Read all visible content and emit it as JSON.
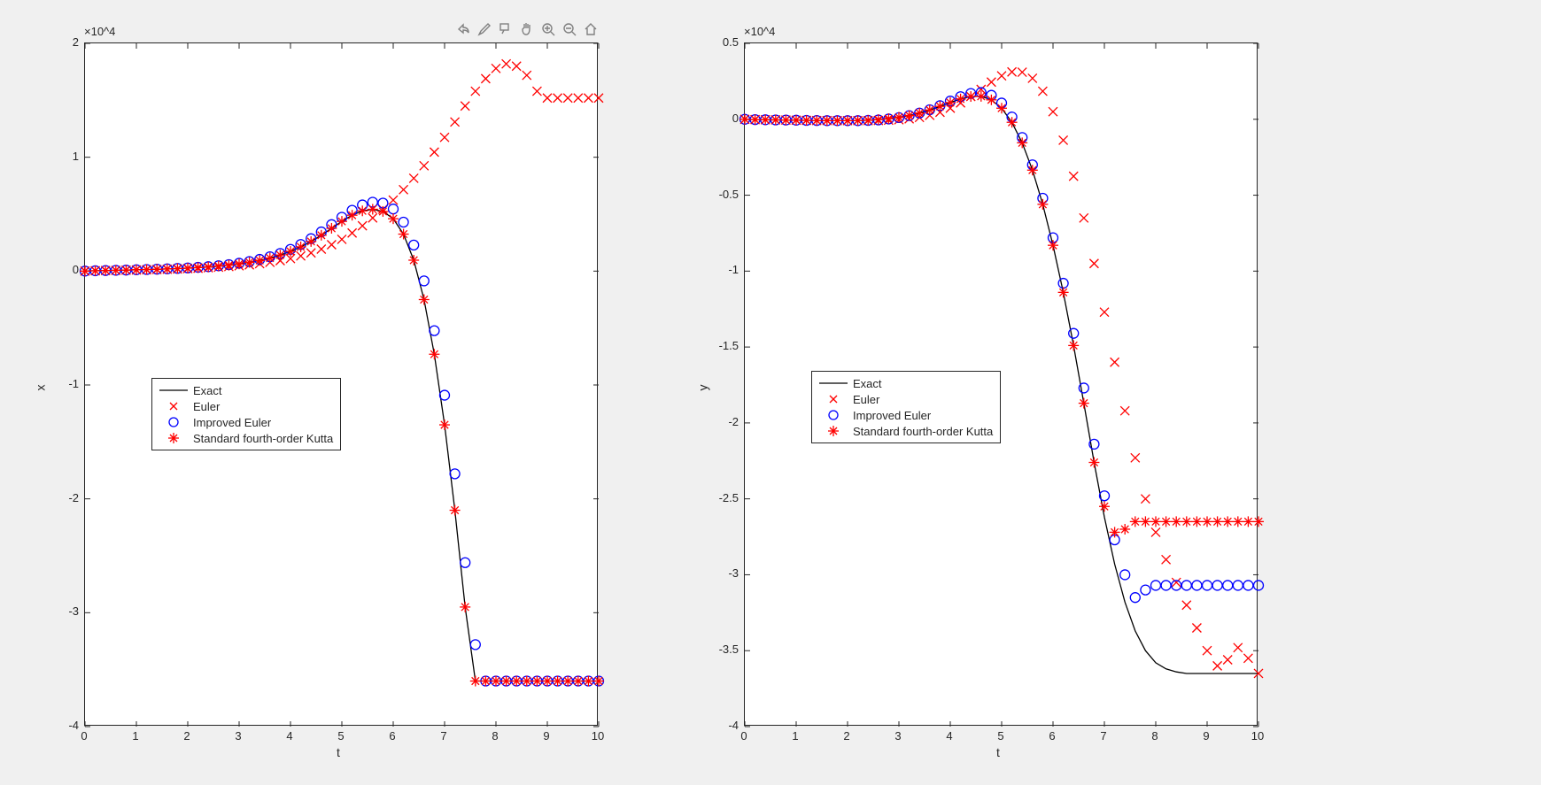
{
  "toolbar_icons": [
    "share-icon",
    "brush-icon",
    "data-tip-icon",
    "pan-icon",
    "zoom-in-icon",
    "zoom-out-icon",
    "home-icon"
  ],
  "legend": {
    "items": [
      "Exact",
      "Euler",
      "Improved Euler",
      "Standard fourth-order Kutta"
    ]
  },
  "chart_data": [
    {
      "type": "line",
      "xlabel": "t",
      "ylabel": "x",
      "xlim": [
        0,
        10
      ],
      "ylim": [
        -4,
        2
      ],
      "yscale": 10000.0,
      "yexp": "×10^4",
      "xticks": [
        0,
        1,
        2,
        3,
        4,
        5,
        6,
        7,
        8,
        9,
        10
      ],
      "yticks": [
        -4,
        -3,
        -2,
        -1,
        0,
        1,
        2
      ],
      "x": [
        0,
        0.2,
        0.4,
        0.6,
        0.8,
        1,
        1.2,
        1.4,
        1.6,
        1.8,
        2,
        2.2,
        2.4,
        2.6,
        2.8,
        3,
        3.2,
        3.4,
        3.6,
        3.8,
        4,
        4.2,
        4.4,
        4.6,
        4.8,
        5,
        5.2,
        5.4,
        5.6,
        5.8,
        6,
        6.2,
        6.4,
        6.6,
        6.8,
        7,
        7.2,
        7.4,
        7.6,
        7.8,
        8,
        8.2,
        8.4,
        8.6,
        8.8,
        9,
        9.2,
        9.4,
        9.6,
        9.8,
        10
      ],
      "series": [
        {
          "name": "Exact",
          "style": "line",
          "color": "#000000",
          "values": [
            0,
            0.003,
            0.005,
            0.007,
            0.009,
            0.012,
            0.014,
            0.016,
            0.019,
            0.022,
            0.026,
            0.031,
            0.036,
            0.044,
            0.052,
            0.063,
            0.077,
            0.094,
            0.115,
            0.141,
            0.173,
            0.213,
            0.26,
            0.315,
            0.376,
            0.437,
            0.491,
            0.529,
            0.543,
            0.524,
            0.46,
            0.325,
            0.096,
            -0.25,
            -0.73,
            -1.35,
            -2.1,
            -2.95,
            -3.6,
            -3.6,
            -3.6,
            -3.6,
            -3.6,
            -3.6,
            -3.6,
            -3.6,
            -3.6,
            -3.6,
            -3.6,
            -3.6,
            -3.6
          ]
        },
        {
          "name": "Euler",
          "style": "x",
          "color": "#ff0000",
          "values": [
            0,
            0.003,
            0.005,
            0.006,
            0.008,
            0.01,
            0.012,
            0.014,
            0.016,
            0.019,
            0.022,
            0.025,
            0.029,
            0.034,
            0.04,
            0.047,
            0.055,
            0.065,
            0.077,
            0.092,
            0.11,
            0.133,
            0.16,
            0.193,
            0.232,
            0.279,
            0.335,
            0.398,
            0.467,
            0.542,
            0.624,
            0.715,
            0.815,
            0.925,
            1.045,
            1.175,
            1.31,
            1.45,
            1.58,
            1.69,
            1.78,
            1.82,
            1.8,
            1.72,
            1.58,
            1.52,
            1.52,
            1.52,
            1.52,
            1.52,
            1.52
          ]
        },
        {
          "name": "Improved Euler",
          "style": "o",
          "color": "#0000ff",
          "values": [
            0,
            0.003,
            0.005,
            0.007,
            0.009,
            0.012,
            0.014,
            0.017,
            0.02,
            0.024,
            0.028,
            0.033,
            0.039,
            0.047,
            0.057,
            0.069,
            0.084,
            0.103,
            0.126,
            0.155,
            0.191,
            0.234,
            0.285,
            0.344,
            0.408,
            0.473,
            0.534,
            0.581,
            0.605,
            0.597,
            0.545,
            0.43,
            0.229,
            -0.086,
            -0.523,
            -1.09,
            -1.78,
            -2.56,
            -3.28,
            -3.6,
            -3.6,
            -3.6,
            -3.6,
            -3.6,
            -3.6,
            -3.6,
            -3.6,
            -3.6,
            -3.6,
            -3.6,
            -3.6
          ]
        },
        {
          "name": "Standard fourth-order Kutta",
          "style": "*",
          "color": "#ff0000",
          "values": [
            0,
            0.003,
            0.005,
            0.007,
            0.009,
            0.012,
            0.014,
            0.016,
            0.019,
            0.022,
            0.026,
            0.031,
            0.036,
            0.044,
            0.052,
            0.063,
            0.077,
            0.094,
            0.115,
            0.141,
            0.173,
            0.213,
            0.26,
            0.315,
            0.376,
            0.437,
            0.491,
            0.529,
            0.543,
            0.524,
            0.46,
            0.325,
            0.096,
            -0.25,
            -0.73,
            -1.35,
            -2.1,
            -2.95,
            -3.6,
            -3.6,
            -3.6,
            -3.6,
            -3.6,
            -3.6,
            -3.6,
            -3.6,
            -3.6,
            -3.6,
            -3.6,
            -3.6,
            -3.6
          ]
        }
      ]
    },
    {
      "type": "line",
      "xlabel": "t",
      "ylabel": "y",
      "xlim": [
        0,
        10
      ],
      "ylim": [
        -4,
        0.5
      ],
      "yscale": 10000.0,
      "yexp": "×10^4",
      "xticks": [
        0,
        1,
        2,
        3,
        4,
        5,
        6,
        7,
        8,
        9,
        10
      ],
      "yticks": [
        -4,
        -3.5,
        -3,
        -2.5,
        -2,
        -1.5,
        -1,
        -0.5,
        0,
        0.5
      ],
      "x": [
        0,
        0.2,
        0.4,
        0.6,
        0.8,
        1,
        1.2,
        1.4,
        1.6,
        1.8,
        2,
        2.2,
        2.4,
        2.6,
        2.8,
        3,
        3.2,
        3.4,
        3.6,
        3.8,
        4,
        4.2,
        4.4,
        4.6,
        4.8,
        5,
        5.2,
        5.4,
        5.6,
        5.8,
        6,
        6.2,
        6.4,
        6.6,
        6.8,
        7,
        7.2,
        7.4,
        7.6,
        7.8,
        8,
        8.2,
        8.4,
        8.6,
        8.8,
        9,
        9.2,
        9.4,
        9.6,
        9.8,
        10
      ],
      "series": [
        {
          "name": "Exact",
          "style": "line",
          "color": "#000000",
          "values": [
            0,
            -0.002,
            -0.003,
            -0.004,
            -0.005,
            -0.006,
            -0.007,
            -0.008,
            -0.009,
            -0.009,
            -0.009,
            -0.008,
            -0.006,
            -0.002,
            0.004,
            0.013,
            0.025,
            0.041,
            0.061,
            0.085,
            0.11,
            0.134,
            0.15,
            0.151,
            0.128,
            0.073,
            -0.02,
            -0.155,
            -0.335,
            -0.56,
            -0.83,
            -1.14,
            -1.49,
            -1.87,
            -2.26,
            -2.62,
            -2.93,
            -3.18,
            -3.37,
            -3.5,
            -3.58,
            -3.62,
            -3.64,
            -3.65,
            -3.65,
            -3.65,
            -3.65,
            -3.65,
            -3.65,
            -3.65,
            -3.65
          ]
        },
        {
          "name": "Euler",
          "style": "x",
          "color": "#ff0000",
          "values": [
            0,
            -0.002,
            -0.003,
            -0.004,
            -0.005,
            -0.006,
            -0.007,
            -0.008,
            -0.008,
            -0.009,
            -0.009,
            -0.009,
            -0.009,
            -0.008,
            -0.006,
            -0.003,
            0.003,
            0.012,
            0.026,
            0.046,
            0.073,
            0.108,
            0.15,
            0.197,
            0.245,
            0.286,
            0.312,
            0.31,
            0.27,
            0.185,
            0.05,
            -0.138,
            -0.375,
            -0.65,
            -0.95,
            -1.27,
            -1.6,
            -1.92,
            -2.23,
            -2.5,
            -2.72,
            -2.9,
            -3.05,
            -3.2,
            -3.35,
            -3.5,
            -3.6,
            -3.56,
            -3.48,
            -3.55,
            -3.65
          ]
        },
        {
          "name": "Improved Euler",
          "style": "o",
          "color": "#0000ff",
          "values": [
            0,
            -0.002,
            -0.003,
            -0.004,
            -0.005,
            -0.006,
            -0.007,
            -0.008,
            -0.009,
            -0.009,
            -0.009,
            -0.009,
            -0.007,
            -0.004,
            0.002,
            0.011,
            0.024,
            0.041,
            0.063,
            0.09,
            0.12,
            0.149,
            0.17,
            0.176,
            0.158,
            0.107,
            0.015,
            -0.12,
            -0.3,
            -0.52,
            -0.78,
            -1.08,
            -1.41,
            -1.77,
            -2.14,
            -2.48,
            -2.77,
            -3.0,
            -3.15,
            -3.1,
            -3.07,
            -3.07,
            -3.07,
            -3.07,
            -3.07,
            -3.07,
            -3.07,
            -3.07,
            -3.07,
            -3.07,
            -3.07
          ]
        },
        {
          "name": "Standard fourth-order Kutta",
          "style": "*",
          "color": "#ff0000",
          "values": [
            0,
            -0.002,
            -0.003,
            -0.004,
            -0.005,
            -0.006,
            -0.007,
            -0.008,
            -0.009,
            -0.009,
            -0.009,
            -0.008,
            -0.006,
            -0.002,
            0.004,
            0.013,
            0.025,
            0.041,
            0.061,
            0.085,
            0.11,
            0.134,
            0.15,
            0.151,
            0.128,
            0.073,
            -0.02,
            -0.155,
            -0.335,
            -0.56,
            -0.83,
            -1.14,
            -1.49,
            -1.87,
            -2.26,
            -2.55,
            -2.72,
            -2.7,
            -2.65,
            -2.65,
            -2.65,
            -2.65,
            -2.65,
            -2.65,
            -2.65,
            -2.65,
            -2.65,
            -2.65,
            -2.65,
            -2.65,
            -2.65
          ]
        }
      ]
    }
  ]
}
